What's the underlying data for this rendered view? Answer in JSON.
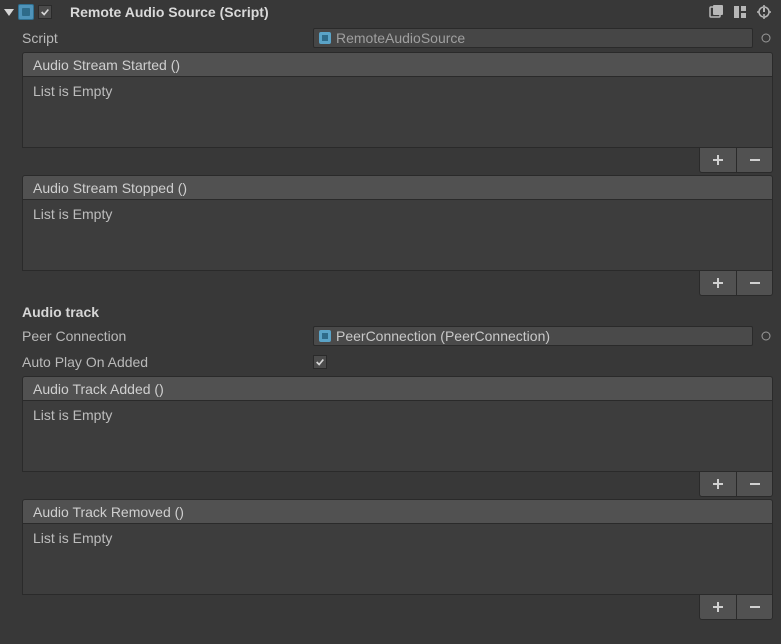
{
  "header": {
    "title": "Remote Audio Source (Script)"
  },
  "fields": {
    "script_label": "Script",
    "script_value": "RemoteAudioSource",
    "peer_label": "Peer Connection",
    "peer_value": "PeerConnection (PeerConnection)",
    "autoplay_label": "Auto Play On Added"
  },
  "sections": {
    "audio_track": "Audio track"
  },
  "events": {
    "stream_started": {
      "title": "Audio Stream Started ()",
      "empty": "List is Empty"
    },
    "stream_stopped": {
      "title": "Audio Stream Stopped ()",
      "empty": "List is Empty"
    },
    "track_added": {
      "title": "Audio Track Added ()",
      "empty": "List is Empty"
    },
    "track_removed": {
      "title": "Audio Track Removed ()",
      "empty": "List is Empty"
    }
  }
}
